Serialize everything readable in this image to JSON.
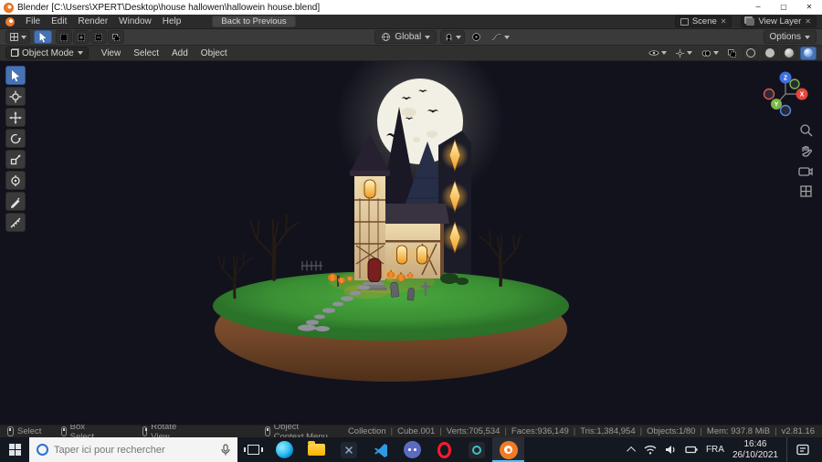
{
  "window": {
    "title": "Blender [C:\\Users\\XPERT\\Desktop\\house hallowen\\hallowein house.blend]"
  },
  "icons": {
    "minimize": "─",
    "maximize": "▢",
    "close": "✕",
    "unlink": "✕"
  },
  "topbar": {
    "menus": [
      "File",
      "Edit",
      "Render",
      "Window",
      "Help"
    ],
    "back_button": "Back to Previous",
    "scene_label": "Scene",
    "view_layer_label": "View Layer"
  },
  "toolrow": {
    "orientation": "Global",
    "options_label": "Options"
  },
  "viewport_header": {
    "mode": "Object Mode",
    "menus": [
      "View",
      "Select",
      "Add",
      "Object"
    ]
  },
  "gizmo": {
    "x": "X",
    "y": "Y",
    "z": "Z"
  },
  "statusbar": {
    "hints": [
      "Select",
      "Box Select",
      "Rotate View",
      "Object Context Menu"
    ],
    "stats": [
      "Collection",
      "Cube.001",
      "Verts:705,534",
      "Faces:936,149",
      "Tris:1,384,954",
      "Objects:1/80",
      "Mem: 937.8 MiB",
      "v2.81.16"
    ]
  },
  "taskbar": {
    "search_placeholder": "Taper ici pour rechercher",
    "language": "FRA",
    "time": "16:46",
    "date": "26/10/2021",
    "app_icons": [
      "edge-icon",
      "file-explorer-icon",
      "dark-app-icon",
      "vscode-icon",
      "discord-icon",
      "opera-icon",
      "dark-app-icon-2",
      "blender-icon"
    ]
  },
  "colors": {
    "accent": "#4772b3",
    "viewportBg": "#12121d",
    "titlebar": "#ffffff",
    "taskbar": "#141821",
    "moon": "#f2efe4",
    "windowGlow": "#ffb53d",
    "grass": "#3a8f33",
    "soil": "#74482a"
  }
}
